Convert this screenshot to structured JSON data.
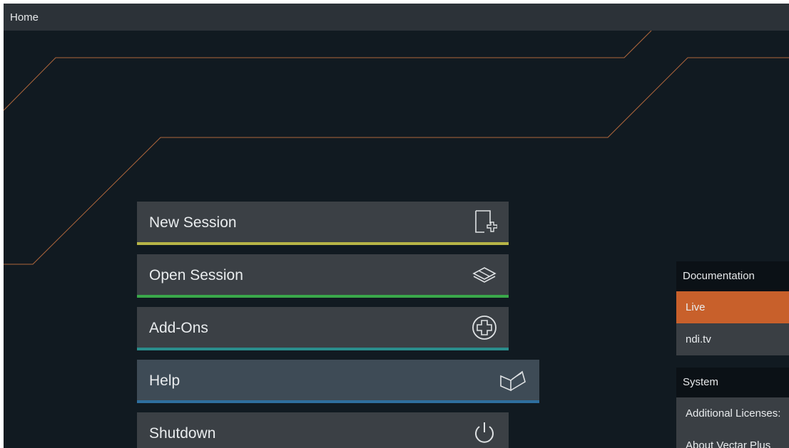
{
  "window": {
    "title": "Home"
  },
  "menu": {
    "items": [
      {
        "label": "New Session",
        "icon": "new-file-icon",
        "accent": "#b7b547"
      },
      {
        "label": "Open Session",
        "icon": "open-layers-icon",
        "accent": "#3aa84a"
      },
      {
        "label": "Add-Ons",
        "icon": "plus-circle-icon",
        "accent": "#2a8d8c"
      },
      {
        "label": "Help",
        "icon": "book-icon",
        "accent": "#2e6e9e",
        "active": true
      },
      {
        "label": "Shutdown",
        "icon": "power-icon",
        "accent": "#5a5f64"
      }
    ]
  },
  "documentation": {
    "heading": "Documentation",
    "items": [
      {
        "label": "Live",
        "selected": true,
        "color": "#c8602b"
      },
      {
        "label": "ndi.tv"
      }
    ]
  },
  "system": {
    "heading": "System",
    "items": [
      {
        "label": "Additional Licenses:"
      },
      {
        "label": "About Vectar Plus"
      }
    ]
  }
}
